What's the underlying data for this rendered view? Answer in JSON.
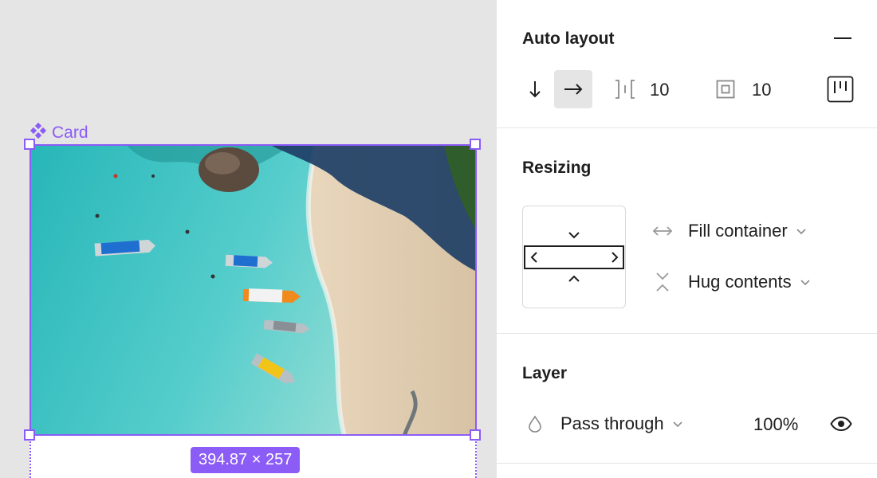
{
  "canvas": {
    "component_label": "Card",
    "component_icon": "component-icon",
    "size_badge": "394.87 × 257",
    "accent_color": "#8b5cf6",
    "image_icon": "beach-photo"
  },
  "auto_layout": {
    "title": "Auto layout",
    "remove_icon": "minus-icon",
    "direction_vertical_icon": "arrow-down-icon",
    "direction_horizontal_icon": "arrow-right-icon",
    "gap_icon": "gap-icon",
    "gap_value": "10",
    "padding_icon": "padding-icon",
    "padding_value": "10",
    "alignment_icon": "alignment-icon"
  },
  "resizing": {
    "title": "Resizing",
    "width_icon": "horizontal-resize-icon",
    "width_mode": "Fill container",
    "height_icon": "vertical-resize-icon",
    "height_mode": "Hug contents"
  },
  "layer": {
    "title": "Layer",
    "blend_icon": "drop-icon",
    "blend_mode": "Pass through",
    "opacity": "100%",
    "visibility_icon": "eye-icon"
  }
}
